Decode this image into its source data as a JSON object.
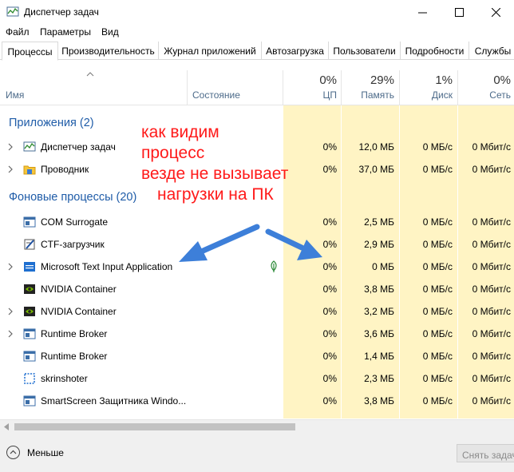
{
  "window": {
    "title": "Диспетчер задач"
  },
  "menu": [
    "Файл",
    "Параметры",
    "Вид"
  ],
  "tabs": [
    "Процессы",
    "Производительность",
    "Журнал приложений",
    "Автозагрузка",
    "Пользователи",
    "Подробности",
    "Службы"
  ],
  "header": {
    "name": "Имя",
    "status": "Состояние",
    "cpu_pct": "0%",
    "cpu": "ЦП",
    "mem_pct": "29%",
    "mem": "Память",
    "disk_pct": "1%",
    "disk": "Диск",
    "net_pct": "0%",
    "net": "Сеть"
  },
  "groups": {
    "apps": "Приложения (2)",
    "background": "Фоновые процессы (20)"
  },
  "processes": [
    {
      "name": "Диспетчер задач",
      "cpu": "0%",
      "mem": "12,0 МБ",
      "disk": "0 МБ/с",
      "net": "0 Мбит/с",
      "icon": "task-manager-icon",
      "expandable": true
    },
    {
      "name": "Проводник",
      "cpu": "0%",
      "mem": "37,0 МБ",
      "disk": "0 МБ/с",
      "net": "0 Мбит/с",
      "icon": "folder-icon",
      "expandable": true
    },
    {
      "name": "COM Surrogate",
      "cpu": "0%",
      "mem": "2,5 МБ",
      "disk": "0 МБ/с",
      "net": "0 Мбит/с",
      "icon": "window-icon",
      "expandable": false
    },
    {
      "name": "CTF-загрузчик",
      "cpu": "0%",
      "mem": "2,9 МБ",
      "disk": "0 МБ/с",
      "net": "0 Мбит/с",
      "icon": "ctf-loader-icon",
      "expandable": false
    },
    {
      "name": "Microsoft Text Input Application",
      "cpu": "0%",
      "mem": "0 МБ",
      "disk": "0 МБ/с",
      "net": "0 Мбит/с",
      "icon": "text-input-icon",
      "expandable": true,
      "suspended": true
    },
    {
      "name": "NVIDIA Container",
      "cpu": "0%",
      "mem": "3,8 МБ",
      "disk": "0 МБ/с",
      "net": "0 Мбит/с",
      "icon": "nvidia-icon",
      "expandable": false
    },
    {
      "name": "NVIDIA Container",
      "cpu": "0%",
      "mem": "3,2 МБ",
      "disk": "0 МБ/с",
      "net": "0 Мбит/с",
      "icon": "nvidia-icon",
      "expandable": true
    },
    {
      "name": "Runtime Broker",
      "cpu": "0%",
      "mem": "3,6 МБ",
      "disk": "0 МБ/с",
      "net": "0 Мбит/с",
      "icon": "window-icon",
      "expandable": true
    },
    {
      "name": "Runtime Broker",
      "cpu": "0%",
      "mem": "1,4 МБ",
      "disk": "0 МБ/с",
      "net": "0 Мбит/с",
      "icon": "window-icon",
      "expandable": false
    },
    {
      "name": "skrinshoter",
      "cpu": "0%",
      "mem": "2,3 МБ",
      "disk": "0 МБ/с",
      "net": "0 Мбит/с",
      "icon": "screenshot-icon",
      "expandable": false
    },
    {
      "name": "SmartScreen Защитника Windo...",
      "cpu": "0%",
      "mem": "3,8 МБ",
      "disk": "0 МБ/с",
      "net": "0 Мбит/с",
      "icon": "window-icon",
      "expandable": false
    }
  ],
  "annotation": {
    "line1": "как видим",
    "line2": "процесс",
    "line3": "везде не вызывает",
    "line4": "нагрузки на ПК"
  },
  "footer": {
    "less": "Меньше",
    "end_task": "Снять задачу"
  },
  "colors": {
    "group_text": "#1f5ca8",
    "annotation": "#ff1a1a",
    "arrow": "#3d7fd9",
    "column_fill": "#fff4c4"
  }
}
